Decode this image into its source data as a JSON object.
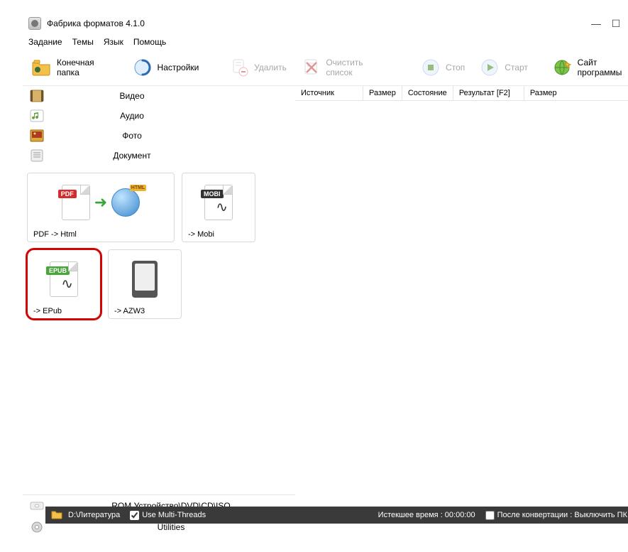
{
  "title": "Фабрика форматов 4.1.0",
  "menu": {
    "task": "Задание",
    "themes": "Темы",
    "language": "Язык",
    "help": "Помощь"
  },
  "toolbar": {
    "output_folder": "Конечная папка",
    "settings": "Настройки",
    "delete": "Удалить",
    "clear": "Очистить список",
    "stop": "Стоп",
    "start": "Старт",
    "website": "Сайт программы"
  },
  "sidenav": {
    "video": "Видео",
    "audio": "Аудио",
    "photo": "Фото",
    "document": "Документ"
  },
  "tiles": {
    "pdf_html": "PDF -> Html",
    "mobi": "-> Mobi",
    "epub": "-> EPub",
    "azw3": "-> AZW3",
    "badge_pdf": "PDF",
    "badge_mobi": "MOBI",
    "badge_epub": "EPUB",
    "badge_html": "HTML"
  },
  "bottom": {
    "rom": "ROM Устройство\\DVD\\CD\\ISO",
    "utilities": "Utilities"
  },
  "columns": {
    "source": "Источник",
    "size": "Размер",
    "state": "Состояние",
    "result": "Результат [F2]",
    "size2": "Размер"
  },
  "status": {
    "path": "D:\\Литература",
    "multithreads": "Use Multi-Threads",
    "elapsed": "Истекшее время : 00:00:00",
    "after": "После конвертации : Выключить ПК"
  }
}
